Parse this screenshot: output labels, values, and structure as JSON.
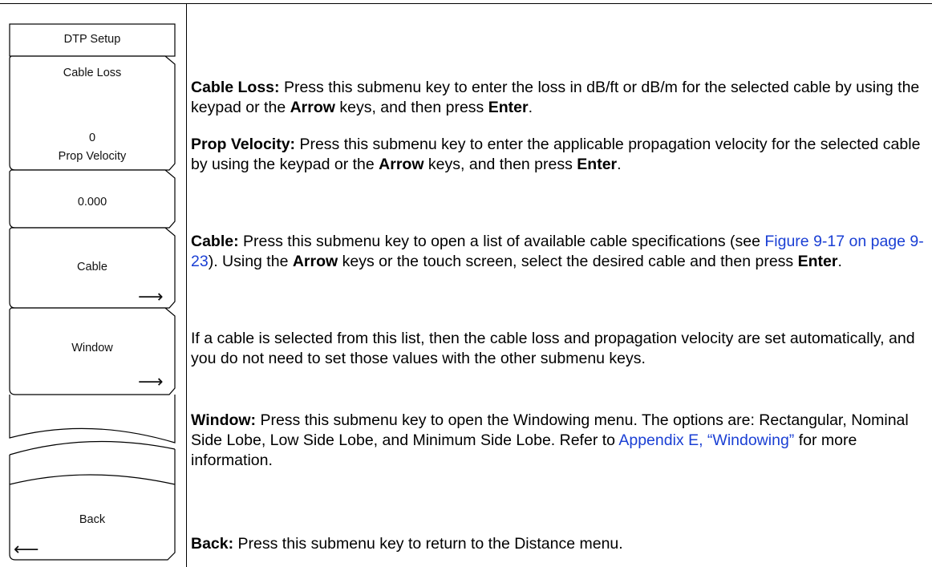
{
  "menu": {
    "title": "DTP Setup",
    "keys": {
      "cable_loss": {
        "label": "Cable Loss",
        "value": "0"
      },
      "prop_velocity": {
        "label": "Prop Velocity",
        "value": "0.000"
      },
      "cable": {
        "label": "Cable"
      },
      "window": {
        "label": "Window"
      },
      "back": {
        "label": "Back"
      }
    }
  },
  "descriptions": {
    "cable_loss": {
      "term": "Cable Loss:",
      "t1": " Press this submenu key to enter the loss in dB/ft or dB/m for the selected cable by using the keypad or the ",
      "b1": "Arrow",
      "t2": " keys, and then press ",
      "b2": "Enter",
      "t3": "."
    },
    "prop_velocity": {
      "term": "Prop Velocity:",
      "t1": " Press this submenu key to enter the applicable propagation velocity for the selected cable by using the keypad or the ",
      "b1": "Arrow",
      "t2": " keys, and then press ",
      "b2": "Enter",
      "t3": "."
    },
    "cable": {
      "term": "Cable:",
      "t1": " Press this submenu key to open a list of available cable specifications (see ",
      "link": "Figure 9-17 on page 9-23",
      "t2": "). Using the ",
      "b1": "Arrow",
      "t3": " keys or the touch screen, select the desired cable and then press ",
      "b2": "Enter",
      "t4": "."
    },
    "cable_note": "If a cable is selected from this list, then the cable loss and propagation velocity are set automatically, and you do not need to set those values with the other submenu keys.",
    "window": {
      "term": "Window:",
      "t1": " Press this submenu key to open the Windowing menu. The options are:  Rectangular, Nominal Side Lobe, Low Side Lobe, and Minimum Side Lobe. Refer to ",
      "link": "Appendix E, “Windowing”",
      "t2": " for more information."
    },
    "back": {
      "term": "Back:",
      "t1": " Press this submenu key to return to the Distance menu."
    }
  }
}
